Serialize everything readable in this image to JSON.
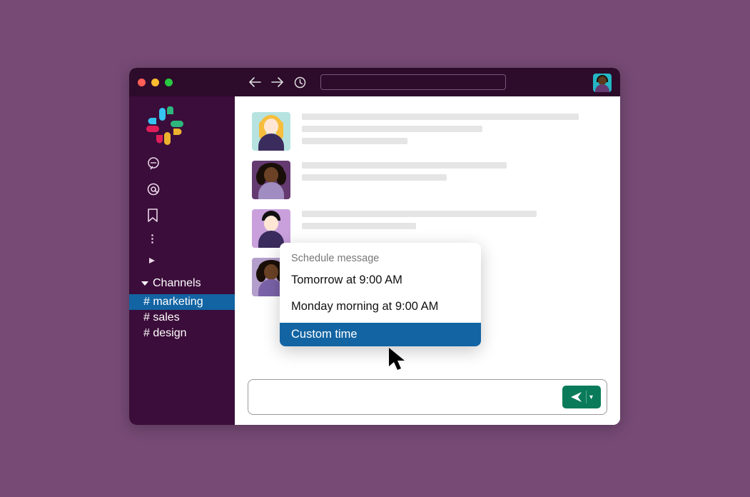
{
  "sidebar": {
    "section_label": "Channels",
    "channels": [
      {
        "label": "# marketing",
        "active": true
      },
      {
        "label": "# sales",
        "active": false
      },
      {
        "label": "# design",
        "active": false
      }
    ]
  },
  "popover": {
    "title": "Schedule message",
    "options": [
      {
        "label": "Tomorrow at 9:00 AM",
        "highlighted": false
      },
      {
        "label": "Monday morning at 9:00 AM",
        "highlighted": false
      },
      {
        "label": "Custom time",
        "highlighted": true
      }
    ]
  }
}
